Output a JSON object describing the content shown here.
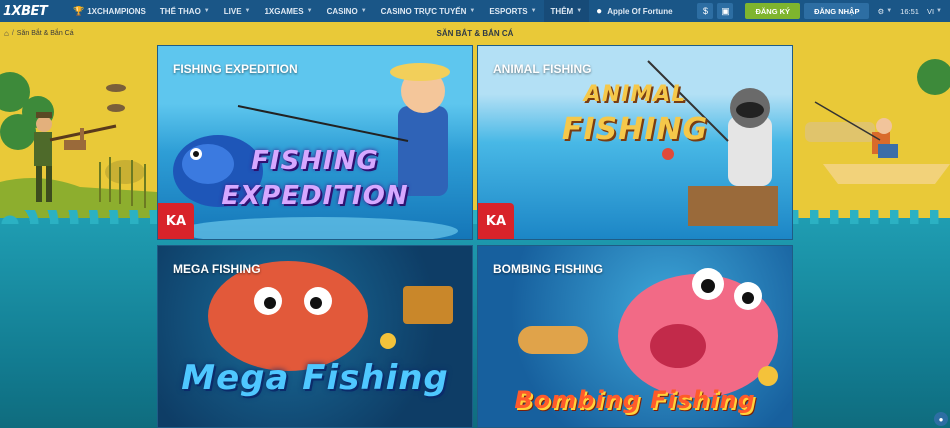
{
  "brand": {
    "logo_text": "1XBET"
  },
  "nav": {
    "items": [
      {
        "label": "1XCHAMPIONS",
        "icon": "trophy-icon",
        "dropdown": false
      },
      {
        "label": "THỂ THAO",
        "dropdown": true
      },
      {
        "label": "LIVE",
        "dropdown": true
      },
      {
        "label": "1XGAMES",
        "dropdown": true
      },
      {
        "label": "CASINO",
        "dropdown": true
      },
      {
        "label": "CASINO TRỰC TUYẾN",
        "dropdown": true
      },
      {
        "label": "ESPORTS",
        "dropdown": true
      },
      {
        "label": "THÊM",
        "dropdown": true
      },
      {
        "label": "Apple Of Fortune",
        "icon": "apple-icon",
        "dropdown": false
      }
    ]
  },
  "header": {
    "register_label": "ĐĂNG KÝ",
    "login_label": "ĐĂNG NHẬP",
    "time": "16:51",
    "language": "VI",
    "currency_symbol": "$"
  },
  "breadcrumb": {
    "current": "Săn Bắt & Bắn Cá"
  },
  "page": {
    "title": "SĂN BẮT & BẮN CÁ"
  },
  "games": [
    {
      "title": "FISHING EXPEDITION",
      "art_line1": "FISHING",
      "art_line2": "EXPEDITION",
      "provider": "KA"
    },
    {
      "title": "ANIMAL FISHING",
      "art_line1": "ANIMAL",
      "art_line2": "FISHING",
      "provider": "KA"
    },
    {
      "title": "MEGA FISHING",
      "art_line1": "Mega Fishing"
    },
    {
      "title": "BOMBING FISHING",
      "art_line1": "Bombing Fishing"
    }
  ],
  "colors": {
    "nav_bg": "#1a5687",
    "register": "#7fb52e",
    "login": "#2d6ea3",
    "page_bg": "#e9c938",
    "sea": "#1f9db2"
  }
}
